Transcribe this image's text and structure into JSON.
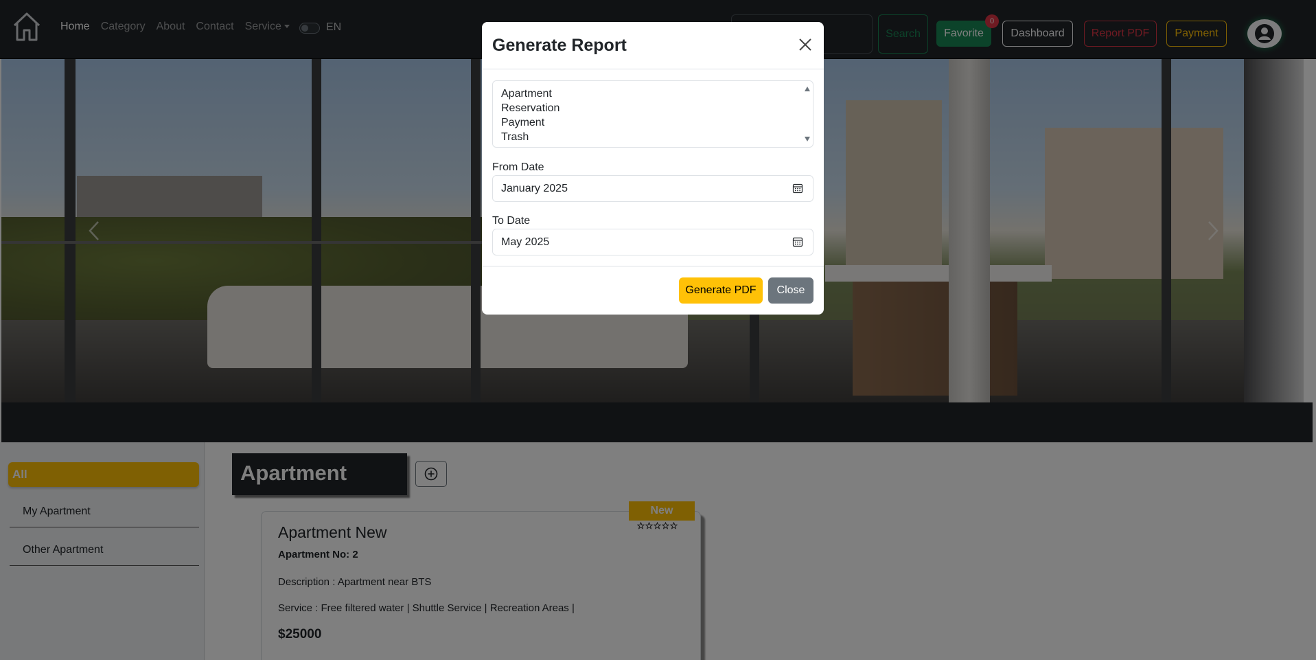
{
  "navbar": {
    "links": [
      "Home",
      "Category",
      "About",
      "Contact",
      "Service"
    ],
    "lang": "EN",
    "search_placeholder": "",
    "search_button": "Search",
    "favorite_label": "Favorite",
    "favorite_count": "0",
    "dashboard_label": "Dashboard",
    "report_label": "Report PDF",
    "payment_label": "Payment"
  },
  "sidebar": {
    "all_label": "All",
    "items": [
      "My Apartment",
      "Other Apartment"
    ]
  },
  "main": {
    "section_title": "Apartment",
    "card": {
      "badge": "New",
      "title": "Apartment New",
      "number": "Apartment No: 2",
      "description": "Description : Apartment near BTS",
      "service": "Service : Free filtered water | Shuttle Service | Recreation Areas |",
      "price": "$25000"
    }
  },
  "modal": {
    "title": "Generate Report",
    "report_types": [
      "Apartment",
      "Reservation",
      "Payment",
      "Trash"
    ],
    "from_label": "From Date",
    "from_value": "January 2025",
    "to_label": "To Date",
    "to_value": "May 2025",
    "generate_label": "Generate PDF",
    "close_label": "Close"
  },
  "colors": {
    "navbar": "#212529",
    "success": "#198754",
    "danger": "#dc3545",
    "warning": "#ffc107",
    "secondary": "#6c757d"
  }
}
